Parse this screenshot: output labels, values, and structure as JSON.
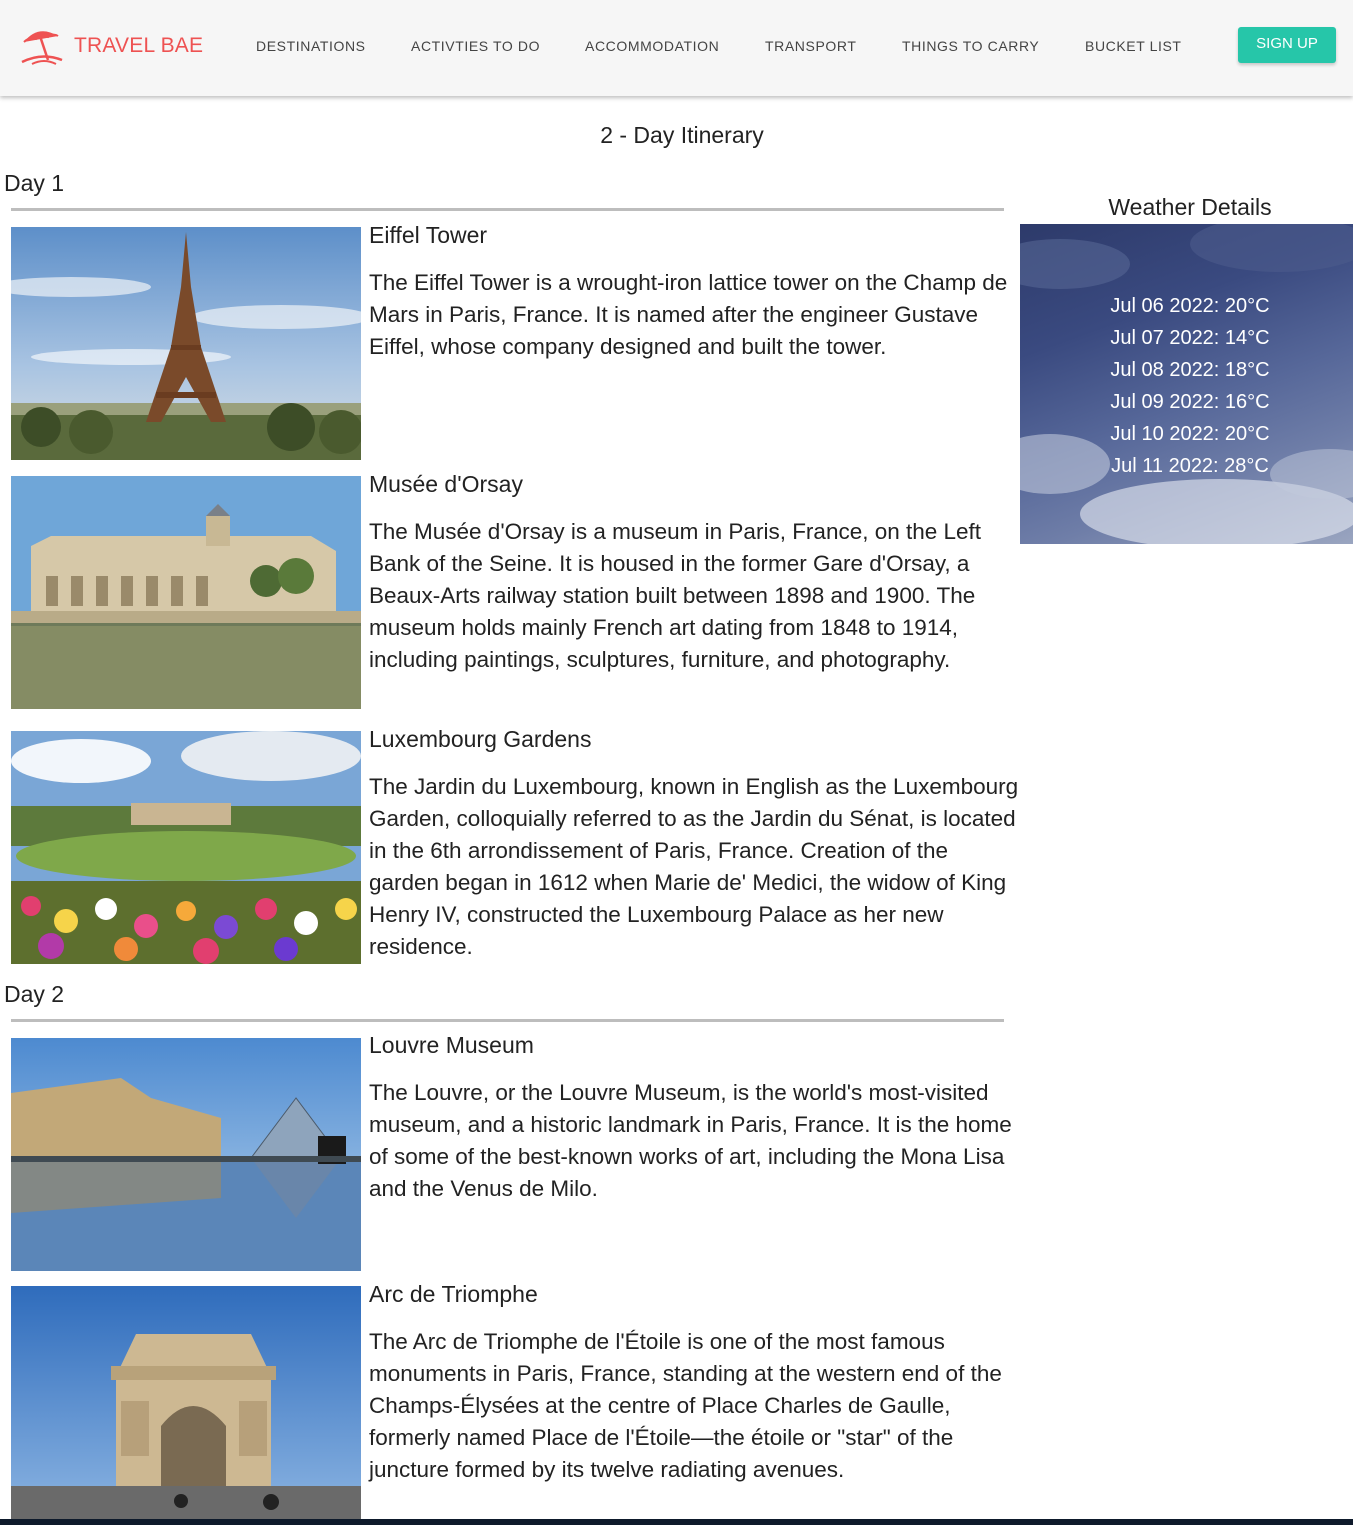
{
  "brand": {
    "name": "TRAVEL BAE",
    "color": "#ee5252"
  },
  "nav": [
    {
      "label": "DESTINATIONS"
    },
    {
      "label": "ACTIVTIES TO DO"
    },
    {
      "label": "ACCOMMODATION"
    },
    {
      "label": "TRANSPORT"
    },
    {
      "label": "THINGS TO CARRY"
    },
    {
      "label": "BUCKET LIST"
    }
  ],
  "signup_label": "SIGN UP",
  "accent_color": "#26c6a9",
  "title": "2 - Day Itinerary",
  "days": [
    {
      "label": "Day 1",
      "places": [
        {
          "name": "Eiffel Tower",
          "image": "eiffel-tower-photo",
          "description": "The Eiffel Tower is a wrought-iron lattice tower on the Champ de Mars in Paris, France. It is named after the engineer Gustave Eiffel, whose company designed and built the tower."
        },
        {
          "name": "Musée d'Orsay",
          "image": "musee-dorsay-photo",
          "description": "The Musée d'Orsay is a museum in Paris, France, on the Left Bank of the Seine. It is housed in the former Gare d'Orsay, a Beaux-Arts railway station built between 1898 and 1900. The museum holds mainly French art dating from 1848 to 1914, including paintings, sculptures, furniture, and photography."
        },
        {
          "name": "Luxembourg Gardens",
          "image": "luxembourg-gardens-photo",
          "description": "The Jardin du Luxembourg, known in English as the Luxembourg Garden, colloquially referred to as the Jardin du Sénat, is located in the 6th arrondissement of Paris, France. Creation of the garden began in 1612 when Marie de' Medici, the widow of King Henry IV, constructed the Luxembourg Palace as her new residence."
        }
      ]
    },
    {
      "label": "Day 2",
      "places": [
        {
          "name": "Louvre Museum",
          "image": "louvre-museum-photo",
          "description": "The Louvre, or the Louvre Museum, is the world's most-visited museum, and a historic landmark in Paris, France. It is the home of some of the best-known works of art, including the Mona Lisa and the Venus de Milo."
        },
        {
          "name": "Arc de Triomphe",
          "image": "arc-de-triomphe-photo",
          "description": "The Arc de Triomphe de l'Étoile is one of the most famous monuments in Paris, France, standing at the western end of the Champs-Élysées at the centre of Place Charles de Gaulle, formerly named Place de l'Étoile—the étoile or \"star\" of the juncture formed by its twelve radiating avenues."
        }
      ]
    }
  ],
  "weather": {
    "title": "Weather Details",
    "forecast": [
      "Jul 06 2022: 20°C",
      "Jul 07 2022: 14°C",
      "Jul 08 2022: 18°C",
      "Jul 09 2022: 16°C",
      "Jul 10 2022: 20°C",
      "Jul 11 2022: 28°C"
    ]
  }
}
